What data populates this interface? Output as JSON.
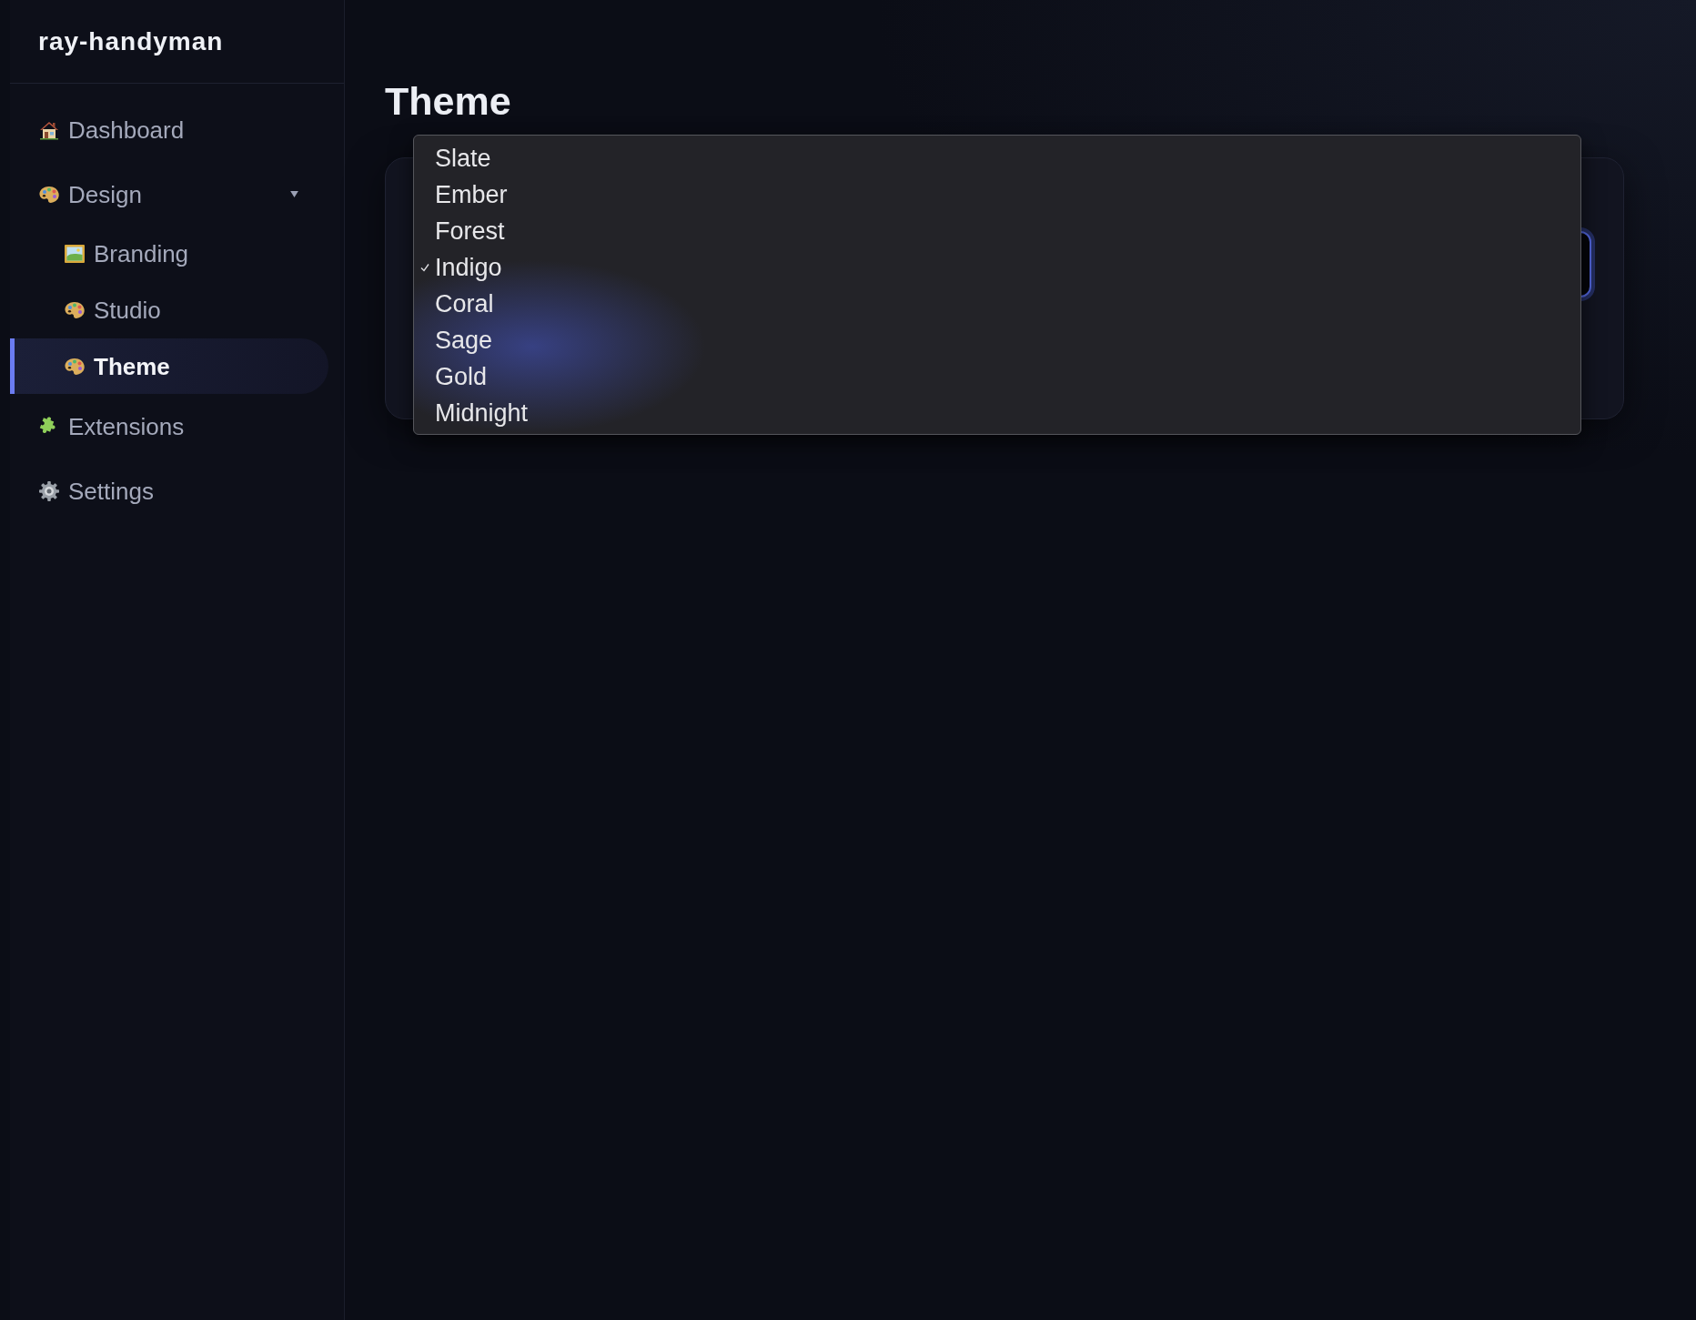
{
  "sidebar": {
    "title": "ray-handyman",
    "items": [
      {
        "label": "Dashboard",
        "selected": false
      },
      {
        "label": "Design",
        "selected": false,
        "expanded": true,
        "children": [
          {
            "label": "Branding",
            "selected": false
          },
          {
            "label": "Studio",
            "selected": false
          },
          {
            "label": "Theme",
            "selected": true
          }
        ]
      },
      {
        "label": "Extensions",
        "selected": false
      },
      {
        "label": "Settings",
        "selected": false
      }
    ]
  },
  "main": {
    "title": "Theme",
    "theme_menu": {
      "options": [
        {
          "label": "Slate",
          "selected": false
        },
        {
          "label": "Ember",
          "selected": false
        },
        {
          "label": "Forest",
          "selected": false
        },
        {
          "label": "Indigo",
          "selected": true
        },
        {
          "label": "Coral",
          "selected": false
        },
        {
          "label": "Sage",
          "selected": false
        },
        {
          "label": "Gold",
          "selected": false
        },
        {
          "label": "Midnight",
          "selected": false
        }
      ]
    }
  }
}
